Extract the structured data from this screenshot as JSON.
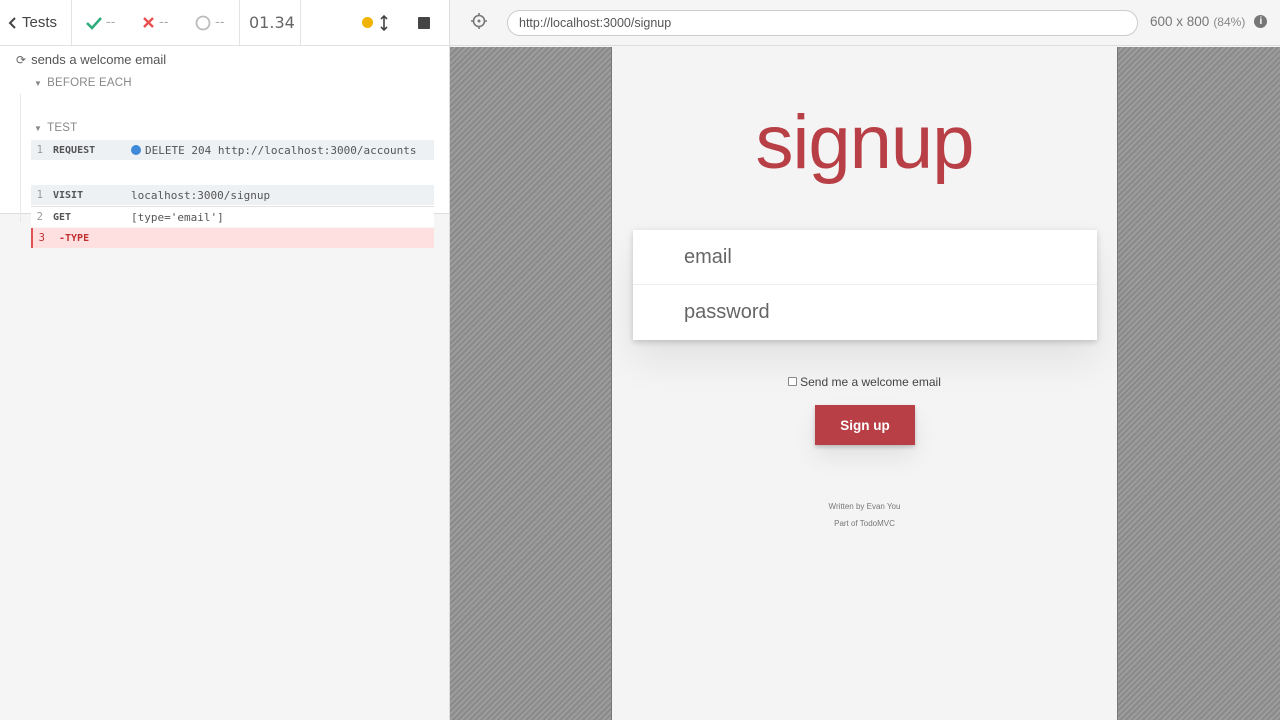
{
  "reporter": {
    "tests_label": "Tests",
    "passed": "--",
    "failed": "--",
    "pending": "--",
    "duration": "01.34",
    "test_title": "sends a welcome email",
    "hooks": {
      "before_each": "BEFORE EACH",
      "test": "TEST"
    },
    "commands": [
      {
        "num": "1",
        "name": "REQUEST",
        "message": "DELETE 204 http://localhost:3000/accounts"
      },
      {
        "num": "1",
        "name": "VISIT",
        "message": "localhost:3000/signup"
      },
      {
        "num": "2",
        "name": "GET",
        "message": "[type='email']"
      },
      {
        "num": "3",
        "name": "-TYPE",
        "message": ""
      }
    ]
  },
  "urlbar": {
    "url": "http://localhost:3000/signup",
    "viewport": "600 x 800",
    "scale": "(84%)"
  },
  "app": {
    "title": "signup",
    "email_placeholder": "email",
    "password_placeholder": "password",
    "welcome_label": "Send me a welcome email",
    "signup_button": "Sign up",
    "footer_line1": "Written by Evan You",
    "footer_line2": "Part of TodoMVC"
  },
  "colors": {
    "brand": "#b83f45",
    "pass": "#2dac7d",
    "fail": "#e94f4f",
    "running": "#f0b400"
  }
}
